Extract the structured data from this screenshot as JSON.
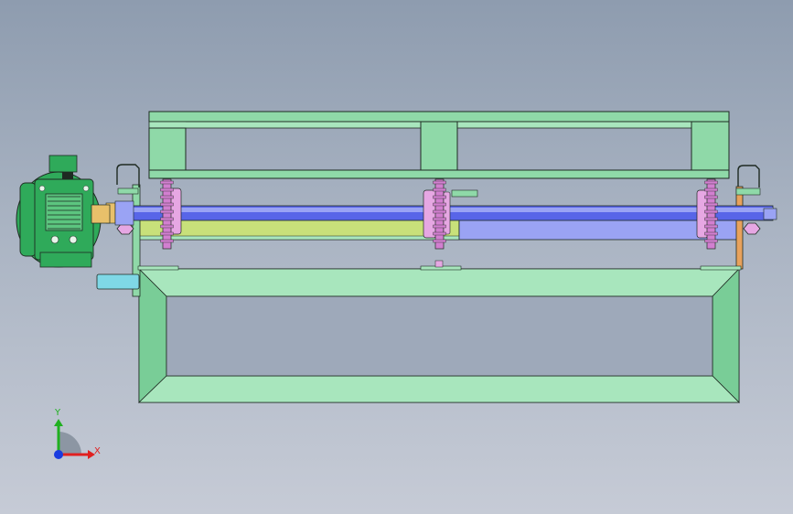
{
  "viewport": {
    "background_top": "#8e9caf",
    "background_bottom": "#c6cbd6"
  },
  "colors": {
    "frame_green": "#8fd9a8",
    "frame_green_light": "#a8e6bd",
    "frame_green_dark": "#79cd97",
    "motor_green": "#2faa5a",
    "shaft_blue": "#5865e8",
    "shaft_blue_light": "#9aa3f4",
    "sprocket_pink": "#d27fd0",
    "bearing_pink": "#e6a7e3",
    "yellow_green_bar": "#c8e07a",
    "orange_plate": "#e8a25c",
    "cyan_stub": "#7fd8e6",
    "outline": "#1e2a22",
    "axis_x": "#e02020",
    "axis_y": "#20b020",
    "axis_z": "#1a3ce0"
  },
  "icons": {
    "triad": "coordinate-triad-icon"
  },
  "triad": {
    "x_label": "X",
    "y_label": "Y"
  }
}
